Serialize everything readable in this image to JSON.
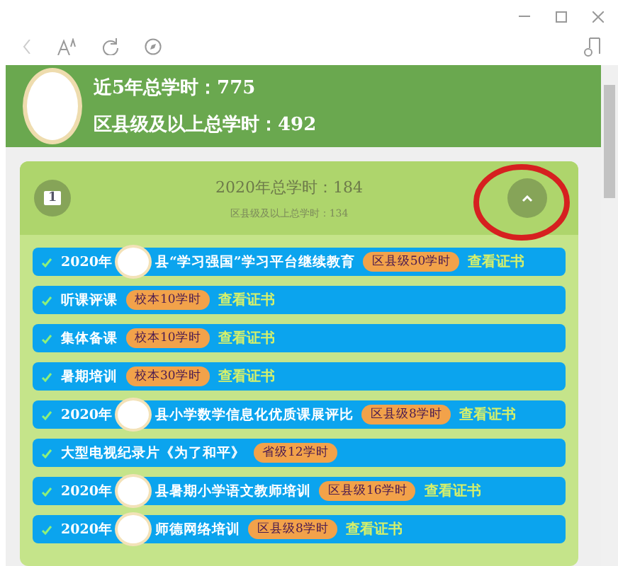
{
  "summary": {
    "lines": [
      "近5年总学时：775",
      "区县级及以上总学时：492"
    ]
  },
  "year_card": {
    "index": "1",
    "title": "2020年总学时：184",
    "subtitle": "区县级及以上总学时：134",
    "expanded": true,
    "highlighted": true
  },
  "records": [
    {
      "done": true,
      "title": "2020年",
      "title_rest": "县“学习强国”学习平台继续教育",
      "redacted": true,
      "badge": "区县级50学时",
      "link": "查看证书"
    },
    {
      "done": true,
      "title": "听课评课",
      "badge": "校本10学时",
      "link": "查看证书"
    },
    {
      "done": true,
      "title": "集体备课",
      "badge": "校本10学时",
      "link": "查看证书"
    },
    {
      "done": true,
      "title": "暑期培训",
      "badge": "校本30学时",
      "link": "查看证书"
    },
    {
      "done": true,
      "title": "2020年",
      "title_rest": "县小学数学信息化优质课展评比",
      "redacted": true,
      "badge": "区县级8学时",
      "link": "查看证书"
    },
    {
      "done": true,
      "title": "大型电视纪录片《为了和平》",
      "badge": "省级12学时"
    },
    {
      "done": true,
      "title": "2020年",
      "title_rest": "县暑期小学语文教师培训",
      "redacted": true,
      "badge": "区县级16学时",
      "link": "查看证书"
    },
    {
      "done": true,
      "title": "2020年",
      "title_rest": "师德网络培训",
      "redacted": true,
      "badge": "区县级8学时",
      "link": "查看证书"
    }
  ]
}
